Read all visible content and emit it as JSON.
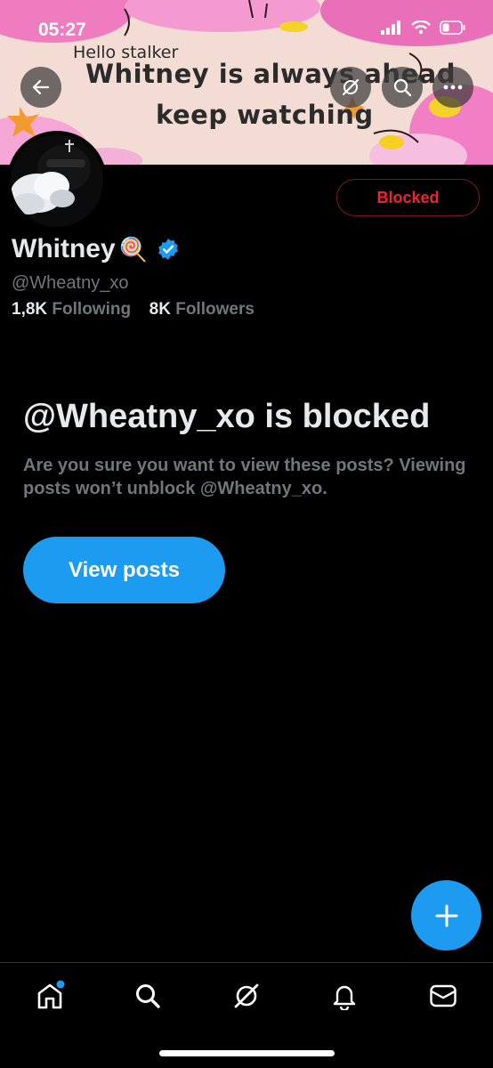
{
  "status_bar": {
    "time": "05:27"
  },
  "banner": {
    "greeting": "Hello stalker",
    "line1": "Whitney is always ahead",
    "line2": "keep watching"
  },
  "profile": {
    "display_name": "Whitney",
    "name_emoji": "🍭",
    "verified": true,
    "handle": "@Wheatny_xo",
    "following_count": "1,8K",
    "following_label": "Following",
    "followers_count": "8K",
    "followers_label": "Followers",
    "relationship_button": "Blocked"
  },
  "blocked_notice": {
    "title": "@Wheatny_xo is blocked",
    "description": "Are you sure you want to view these posts? Viewing posts won’t unblock @Wheatny_xo.",
    "action_label": "View posts"
  },
  "tab_bar": {
    "items": [
      {
        "icon": "home-icon",
        "has_notification_dot": true
      },
      {
        "icon": "search-icon"
      },
      {
        "icon": "grok-icon"
      },
      {
        "icon": "bell-icon"
      },
      {
        "icon": "mail-icon"
      }
    ]
  },
  "colors": {
    "accent": "#1d9bf0",
    "blocked_red": "#f4212e",
    "secondary_text": "#71767b"
  }
}
